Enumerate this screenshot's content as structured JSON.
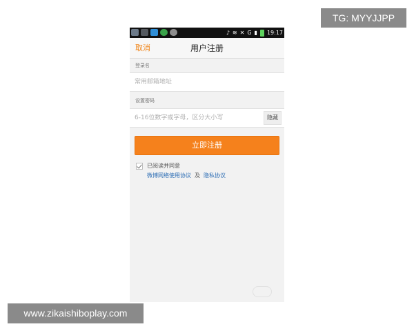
{
  "overlay": {
    "tg_label": "TG: MYYJJPP",
    "site_url": "www.zikaishiboplay.com"
  },
  "status_bar": {
    "time": "19:17",
    "network": "G"
  },
  "nav": {
    "cancel_label": "取消",
    "title": "用户注册"
  },
  "form": {
    "username_label": "登录名",
    "username_placeholder": "常用邮箱地址",
    "password_label": "设置密码",
    "password_placeholder": "6-16位数字或字母，区分大小写",
    "hide_label": "隐藏"
  },
  "register_button_label": "立即注册",
  "agreement": {
    "text": "已阅读并同意",
    "terms_link": "微博网络使用协议",
    "and": "及",
    "privacy_link": "隐私协议"
  },
  "colors": {
    "accent": "#f5811c",
    "link": "#2f6fb5",
    "cancel": "#f08519"
  }
}
